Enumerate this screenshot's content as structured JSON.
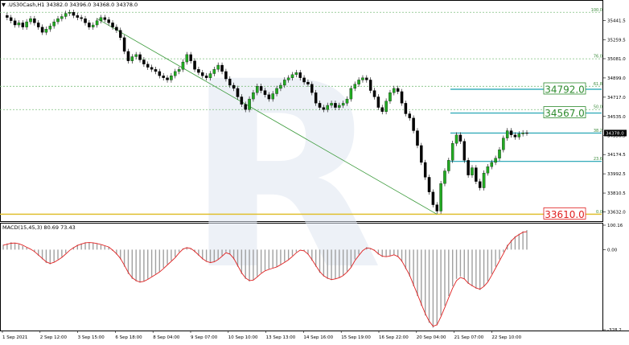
{
  "header": {
    "symbol_line": "▼ .US30Cash,H1  34382.0 34396.0 34368.0 34378.0"
  },
  "chart_data": [
    {
      "type": "candlestick",
      "title": ".US30Cash,H1",
      "ohlc_last": {
        "open": 34382.0,
        "high": 34396.0,
        "low": 34368.0,
        "close": 34378.0
      },
      "ylim": [
        33560,
        35560
      ],
      "y_ticks": [
        35441.5,
        35259.5,
        35081.0,
        34899.0,
        34717.0,
        34535.0,
        34356.5,
        34174.5,
        33992.5,
        33810.5,
        33632.0
      ],
      "x_ticks": [
        "1 Sep 2021",
        "2 Sep 12:00",
        "3 Sep 15:00",
        "6 Sep 18:00",
        "8 Sep 04:00",
        "9 Sep 07:00",
        "10 Sep 10:00",
        "13 Sep 13:00",
        "14 Sep 16:00",
        "15 Sep 19:00",
        "16 Sep 22:00",
        "20 Sep 04:00",
        "21 Sep 07:00",
        "22 Sep 10:00"
      ],
      "close_path": [
        [
          0,
          35490
        ],
        [
          1,
          35470
        ],
        [
          2,
          35440
        ],
        [
          3,
          35400
        ],
        [
          4,
          35420
        ],
        [
          5,
          35380
        ],
        [
          6,
          35430
        ],
        [
          7,
          35460
        ],
        [
          8,
          35420
        ],
        [
          9,
          35380
        ],
        [
          10,
          35330
        ],
        [
          11,
          35360
        ],
        [
          12,
          35390
        ],
        [
          13,
          35430
        ],
        [
          14,
          35460
        ],
        [
          15,
          35480
        ],
        [
          16,
          35510
        ],
        [
          17,
          35520
        ],
        [
          18,
          35490
        ],
        [
          19,
          35470
        ],
        [
          20,
          35460
        ],
        [
          21,
          35420
        ],
        [
          22,
          35380
        ],
        [
          23,
          35400
        ],
        [
          24,
          35440
        ],
        [
          25,
          35470
        ],
        [
          26,
          35450
        ],
        [
          27,
          35420
        ],
        [
          28,
          35380
        ],
        [
          29,
          35350
        ],
        [
          30,
          35280
        ],
        [
          31,
          35150
        ],
        [
          32,
          35060
        ],
        [
          33,
          35100
        ],
        [
          34,
          35120
        ],
        [
          35,
          35070
        ],
        [
          36,
          35030
        ],
        [
          37,
          35000
        ],
        [
          38,
          34980
        ],
        [
          39,
          34960
        ],
        [
          40,
          34920
        ],
        [
          41,
          34900
        ],
        [
          42,
          34880
        ],
        [
          43,
          34920
        ],
        [
          44,
          34960
        ],
        [
          45,
          34980
        ],
        [
          46,
          35050
        ],
        [
          47,
          35120
        ],
        [
          48,
          35060
        ],
        [
          49,
          34980
        ],
        [
          50,
          34950
        ],
        [
          51,
          34920
        ],
        [
          52,
          34900
        ],
        [
          53,
          34940
        ],
        [
          54,
          34980
        ],
        [
          55,
          35020
        ],
        [
          56,
          34960
        ],
        [
          57,
          34890
        ],
        [
          58,
          34830
        ],
        [
          59,
          34800
        ],
        [
          60,
          34720
        ],
        [
          61,
          34650
        ],
        [
          62,
          34600
        ],
        [
          63,
          34700
        ],
        [
          64,
          34760
        ],
        [
          65,
          34820
        ],
        [
          66,
          34780
        ],
        [
          67,
          34740
        ],
        [
          68,
          34700
        ],
        [
          69,
          34750
        ],
        [
          70,
          34800
        ],
        [
          71,
          34830
        ],
        [
          72,
          34880
        ],
        [
          73,
          34900
        ],
        [
          74,
          34930
        ],
        [
          75,
          34950
        ],
        [
          76,
          34900
        ],
        [
          77,
          34860
        ],
        [
          78,
          34840
        ],
        [
          79,
          34760
        ],
        [
          80,
          34660
        ],
        [
          81,
          34620
        ],
        [
          82,
          34600
        ],
        [
          83,
          34640
        ],
        [
          84,
          34660
        ],
        [
          85,
          34620
        ],
        [
          86,
          34640
        ],
        [
          87,
          34660
        ],
        [
          88,
          34700
        ],
        [
          89,
          34800
        ],
        [
          90,
          34840
        ],
        [
          91,
          34880
        ],
        [
          92,
          34900
        ],
        [
          93,
          34880
        ],
        [
          94,
          34780
        ],
        [
          95,
          34720
        ],
        [
          96,
          34620
        ],
        [
          97,
          34580
        ],
        [
          98,
          34680
        ],
        [
          99,
          34760
        ],
        [
          100,
          34800
        ],
        [
          101,
          34770
        ],
        [
          102,
          34660
        ],
        [
          103,
          34560
        ],
        [
          104,
          34520
        ],
        [
          105,
          34400
        ],
        [
          106,
          34260
        ],
        [
          107,
          34100
        ],
        [
          108,
          33960
        ],
        [
          109,
          33820
        ],
        [
          110,
          33700
        ],
        [
          111,
          33640
        ],
        [
          112,
          33900
        ],
        [
          113,
          34020
        ],
        [
          114,
          34120
        ],
        [
          115,
          34280
        ],
        [
          116,
          34360
        ],
        [
          117,
          34300
        ],
        [
          118,
          34120
        ],
        [
          119,
          33980
        ],
        [
          120,
          34050
        ],
        [
          121,
          33920
        ],
        [
          122,
          33860
        ],
        [
          123,
          34000
        ],
        [
          124,
          34060
        ],
        [
          125,
          34100
        ],
        [
          126,
          34140
        ],
        [
          127,
          34220
        ],
        [
          128,
          34330
        ],
        [
          129,
          34400
        ],
        [
          130,
          34360
        ],
        [
          131,
          34340
        ],
        [
          132,
          34370
        ],
        [
          133,
          34380
        ],
        [
          134,
          34378
        ]
      ],
      "fib_levels": [
        {
          "label": "100.0",
          "value": 35520
        },
        {
          "label": "76.0",
          "value": 35080
        },
        {
          "label": "61.8",
          "value": 34820
        },
        {
          "label": "50.0",
          "value": 34600
        },
        {
          "label": "38.2",
          "value": 34378
        },
        {
          "label": "23.6",
          "value": 34110
        },
        {
          "label": "0.0",
          "value": 33610
        }
      ],
      "targets": [
        {
          "label": "34792.0",
          "value": 34792.0,
          "color": "#2e8b2e"
        },
        {
          "label": "34567.0",
          "value": 34567.0,
          "color": "#2e8b2e"
        },
        {
          "label": "33610.0",
          "value": 33610.0,
          "color": "#e02020"
        }
      ],
      "price_marker": "34378.0",
      "trendline": {
        "from": [
          24,
          35460
        ],
        "to": [
          111,
          33610
        ]
      },
      "grid": false,
      "legend": "none"
    },
    {
      "type": "macd",
      "label": "MACD(15,45,3) 80.69 73.43",
      "ylim": [
        -328.2,
        100.16
      ],
      "y_ticks": [
        "100.16",
        "0.00",
        "-328.2"
      ],
      "histogram": [
        20,
        25,
        30,
        28,
        22,
        15,
        8,
        0,
        -10,
        -25,
        -40,
        -55,
        -60,
        -50,
        -40,
        -30,
        -15,
        0,
        10,
        20,
        25,
        30,
        30,
        28,
        25,
        20,
        15,
        10,
        -5,
        -20,
        -40,
        -70,
        -100,
        -120,
        -130,
        -135,
        -130,
        -120,
        -110,
        -100,
        -90,
        -75,
        -60,
        -45,
        -30,
        -10,
        5,
        10,
        5,
        -10,
        -25,
        -40,
        -50,
        -55,
        -50,
        -40,
        -25,
        -10,
        -20,
        -40,
        -70,
        -100,
        -120,
        -130,
        -125,
        -110,
        -95,
        -85,
        -80,
        -75,
        -70,
        -60,
        -50,
        -40,
        -25,
        -10,
        0,
        -5,
        -20,
        -45,
        -70,
        -95,
        -110,
        -120,
        -125,
        -120,
        -115,
        -105,
        -90,
        -70,
        -40,
        -20,
        0,
        10,
        5,
        -5,
        -20,
        -30,
        -30,
        -25,
        -20,
        -30,
        -50,
        -80,
        -110,
        -150,
        -190,
        -230,
        -270,
        -300,
        -320,
        -310,
        -270,
        -230,
        -190,
        -150,
        -120,
        -110,
        -120,
        -140,
        -150,
        -160,
        -165,
        -150,
        -130,
        -100,
        -70,
        -40,
        -10,
        20,
        40,
        55,
        65,
        75,
        80
      ],
      "signal": [
        18,
        22,
        26,
        27,
        24,
        18,
        10,
        2,
        -8,
        -22,
        -36,
        -50,
        -57,
        -52,
        -43,
        -32,
        -18,
        -3,
        8,
        17,
        23,
        28,
        29,
        28,
        25,
        21,
        16,
        11,
        -2,
        -17,
        -36,
        -64,
        -94,
        -115,
        -127,
        -133,
        -130,
        -122,
        -112,
        -102,
        -92,
        -78,
        -63,
        -48,
        -33,
        -14,
        2,
        8,
        5,
        -7,
        -22,
        -37,
        -48,
        -53,
        -50,
        -41,
        -27,
        -13,
        -18,
        -36,
        -65,
        -95,
        -116,
        -127,
        -125,
        -112,
        -98,
        -87,
        -81,
        -76,
        -71,
        -62,
        -52,
        -42,
        -28,
        -13,
        -2,
        -5,
        -18,
        -41,
        -66,
        -90,
        -107,
        -117,
        -123,
        -120,
        -115,
        -106,
        -92,
        -73,
        -45,
        -24,
        -4,
        7,
        5,
        -3,
        -17,
        -27,
        -29,
        -26,
        -21,
        -28,
        -46,
        -75,
        -105,
        -144,
        -183,
        -223,
        -262,
        -293,
        -314,
        -308,
        -275,
        -237,
        -197,
        -158,
        -127,
        -114,
        -120,
        -137,
        -148,
        -157,
        -162,
        -151,
        -133,
        -105,
        -76,
        -46,
        -16,
        14,
        35,
        51,
        62,
        71,
        73.43
      ],
      "signal_color": "#e02020",
      "histogram_color": "#a0a0a0"
    }
  ],
  "watermark": {
    "text": "R"
  }
}
